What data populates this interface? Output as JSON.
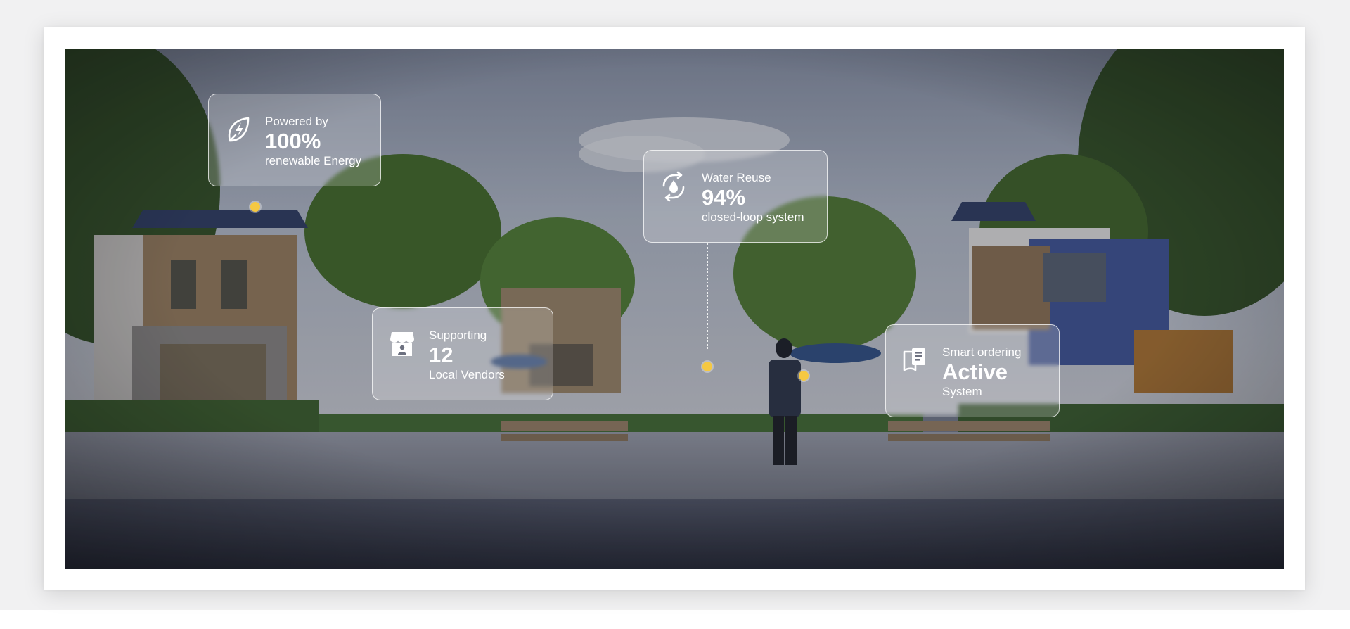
{
  "colors": {
    "page_background": "#f1f1f2",
    "frame": "#ffffff",
    "marker_dot": "#f5c842",
    "callout_text": "#ffffff"
  },
  "callouts": [
    {
      "id": "energy",
      "icon": "leaf-bolt-icon",
      "pre": "Powered by",
      "value": "100%",
      "post": "renewable Energy"
    },
    {
      "id": "water",
      "icon": "water-recycle-icon",
      "pre": "Water Reuse",
      "value": "94%",
      "post": "closed-loop system"
    },
    {
      "id": "vendors",
      "icon": "storefront-icon",
      "pre": "Supporting",
      "value": "12",
      "post": "Local Vendors"
    },
    {
      "id": "ordering",
      "icon": "order-list-icon",
      "pre": "Smart ordering",
      "value": "Active",
      "post": "System"
    }
  ]
}
